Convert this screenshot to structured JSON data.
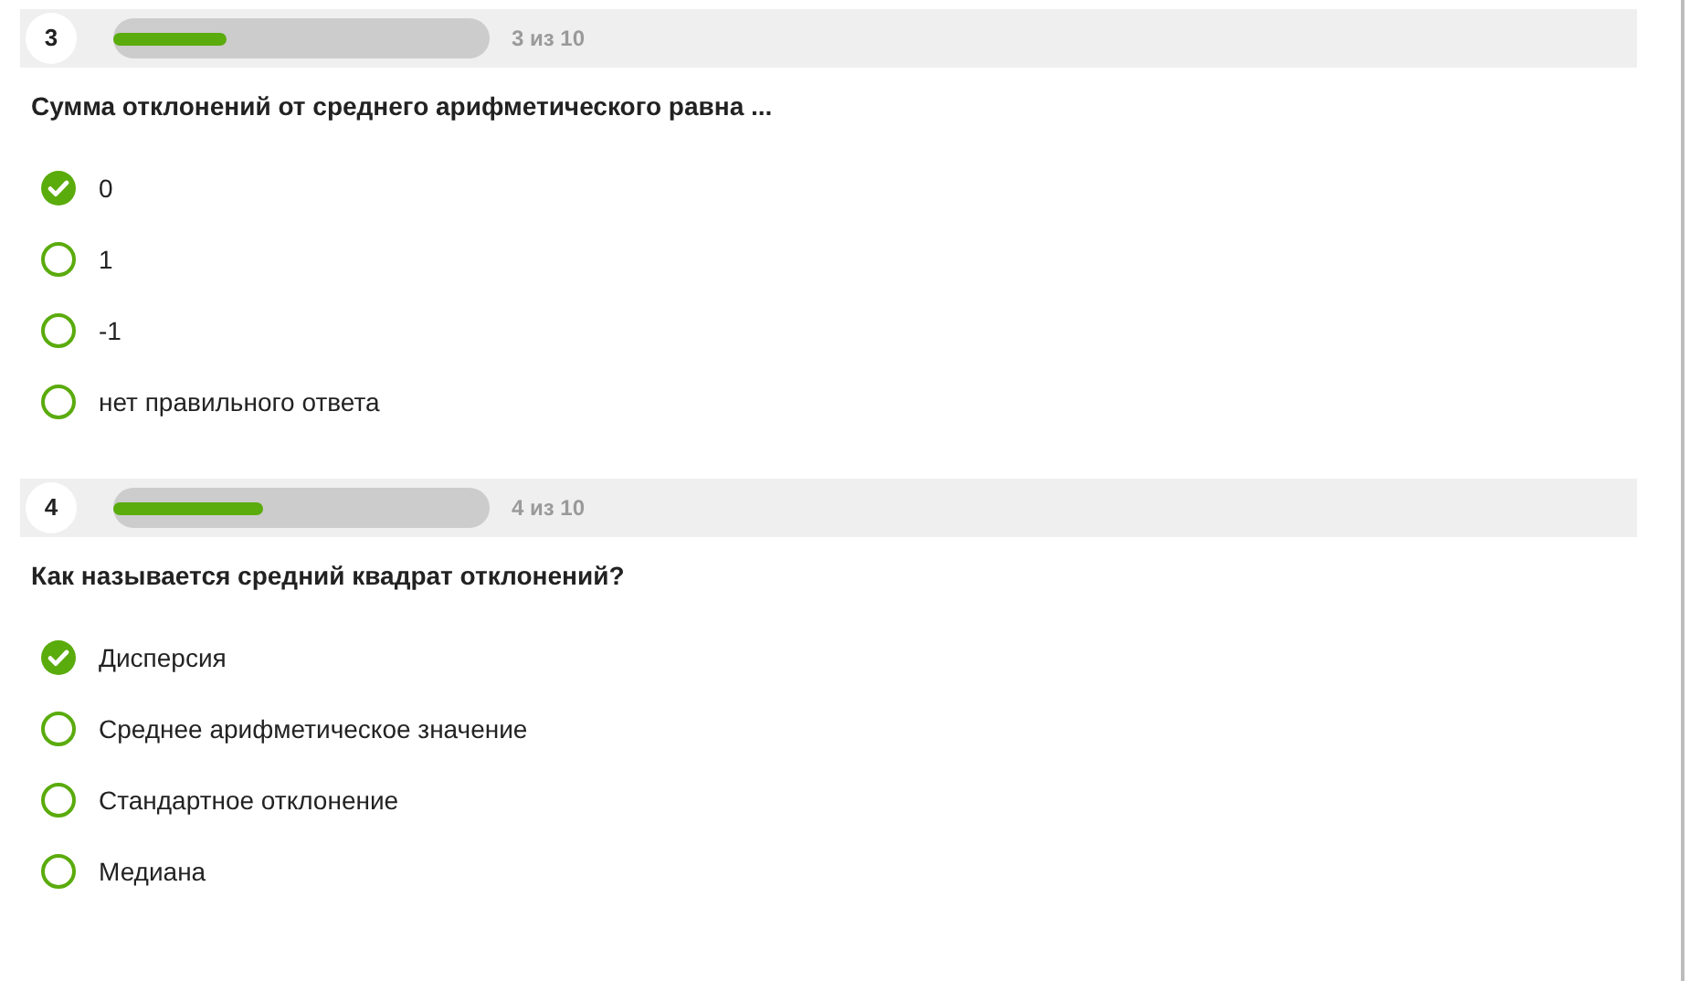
{
  "questions": [
    {
      "number": "3",
      "progress": {
        "level": 0.3
      },
      "counter": "3 из 10",
      "text": "Сумма отклонений от среднего арифметического равна ...",
      "options": [
        {
          "label": "0",
          "selected": true
        },
        {
          "label": "1",
          "selected": false
        },
        {
          "label": "-1",
          "selected": false
        },
        {
          "label": "нет правильного ответа",
          "selected": false
        }
      ]
    },
    {
      "number": "4",
      "progress": {
        "level": 0.4
      },
      "counter": "4 из 10",
      "text": "Как называется средний квадрат отклонений?",
      "options": [
        {
          "label": "Дисперсия",
          "selected": true
        },
        {
          "label": "Среднее арифметическое значение",
          "selected": false
        },
        {
          "label": "Стандартное отклонение",
          "selected": false
        },
        {
          "label": "Медиана",
          "selected": false
        }
      ]
    }
  ]
}
